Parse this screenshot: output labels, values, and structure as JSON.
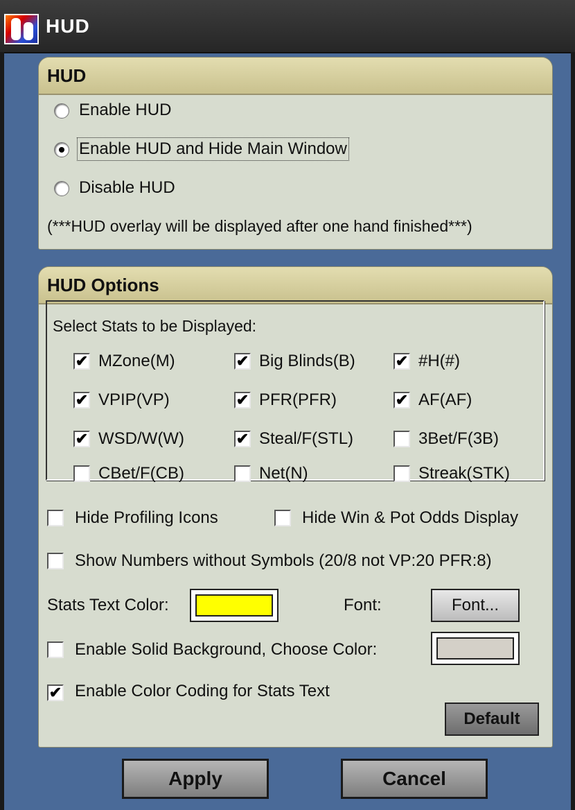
{
  "window": {
    "title": "HUD"
  },
  "hud_section": {
    "header": "HUD",
    "options": [
      {
        "label": "Enable HUD",
        "selected": false
      },
      {
        "label": "Enable HUD and Hide Main Window",
        "selected": true
      },
      {
        "label": "Disable HUD",
        "selected": false
      }
    ],
    "note": "(***HUD overlay will be displayed after one hand finished***)"
  },
  "options_section": {
    "header": "HUD Options",
    "stats_label": "Select Stats to be Displayed:",
    "stats": [
      {
        "label": "MZone(M)",
        "checked": true
      },
      {
        "label": "Big Blinds(B)",
        "checked": true
      },
      {
        "label": "#H(#)",
        "checked": true
      },
      {
        "label": "VPIP(VP)",
        "checked": true
      },
      {
        "label": "PFR(PFR)",
        "checked": true
      },
      {
        "label": "AF(AF)",
        "checked": true
      },
      {
        "label": "WSD/W(W)",
        "checked": true
      },
      {
        "label": "Steal/F(STL)",
        "checked": true
      },
      {
        "label": "3Bet/F(3B)",
        "checked": false
      },
      {
        "label": "CBet/F(CB)",
        "checked": false
      },
      {
        "label": "Net(N)",
        "checked": false
      },
      {
        "label": "Streak(STK)",
        "checked": false
      }
    ],
    "hide_profiling_icons": {
      "label": "Hide Profiling Icons",
      "checked": false
    },
    "hide_win_pot_odds": {
      "label": "Hide Win & Pot Odds Display",
      "checked": false
    },
    "show_numbers": {
      "label": "Show Numbers without Symbols (20/8 not VP:20 PFR:8)",
      "checked": false
    },
    "stats_text_color_label": "Stats Text Color:",
    "stats_text_color": "#ffff00",
    "font_label": "Font:",
    "font_button": "Font...",
    "solid_background": {
      "label": "Enable Solid Background, Choose Color:",
      "checked": false
    },
    "solid_background_color": "#d4d0c8",
    "color_coding": {
      "label": "Enable Color Coding for Stats Text",
      "checked": true
    },
    "default_button": "Default"
  },
  "buttons": {
    "apply": "Apply",
    "cancel": "Cancel"
  }
}
